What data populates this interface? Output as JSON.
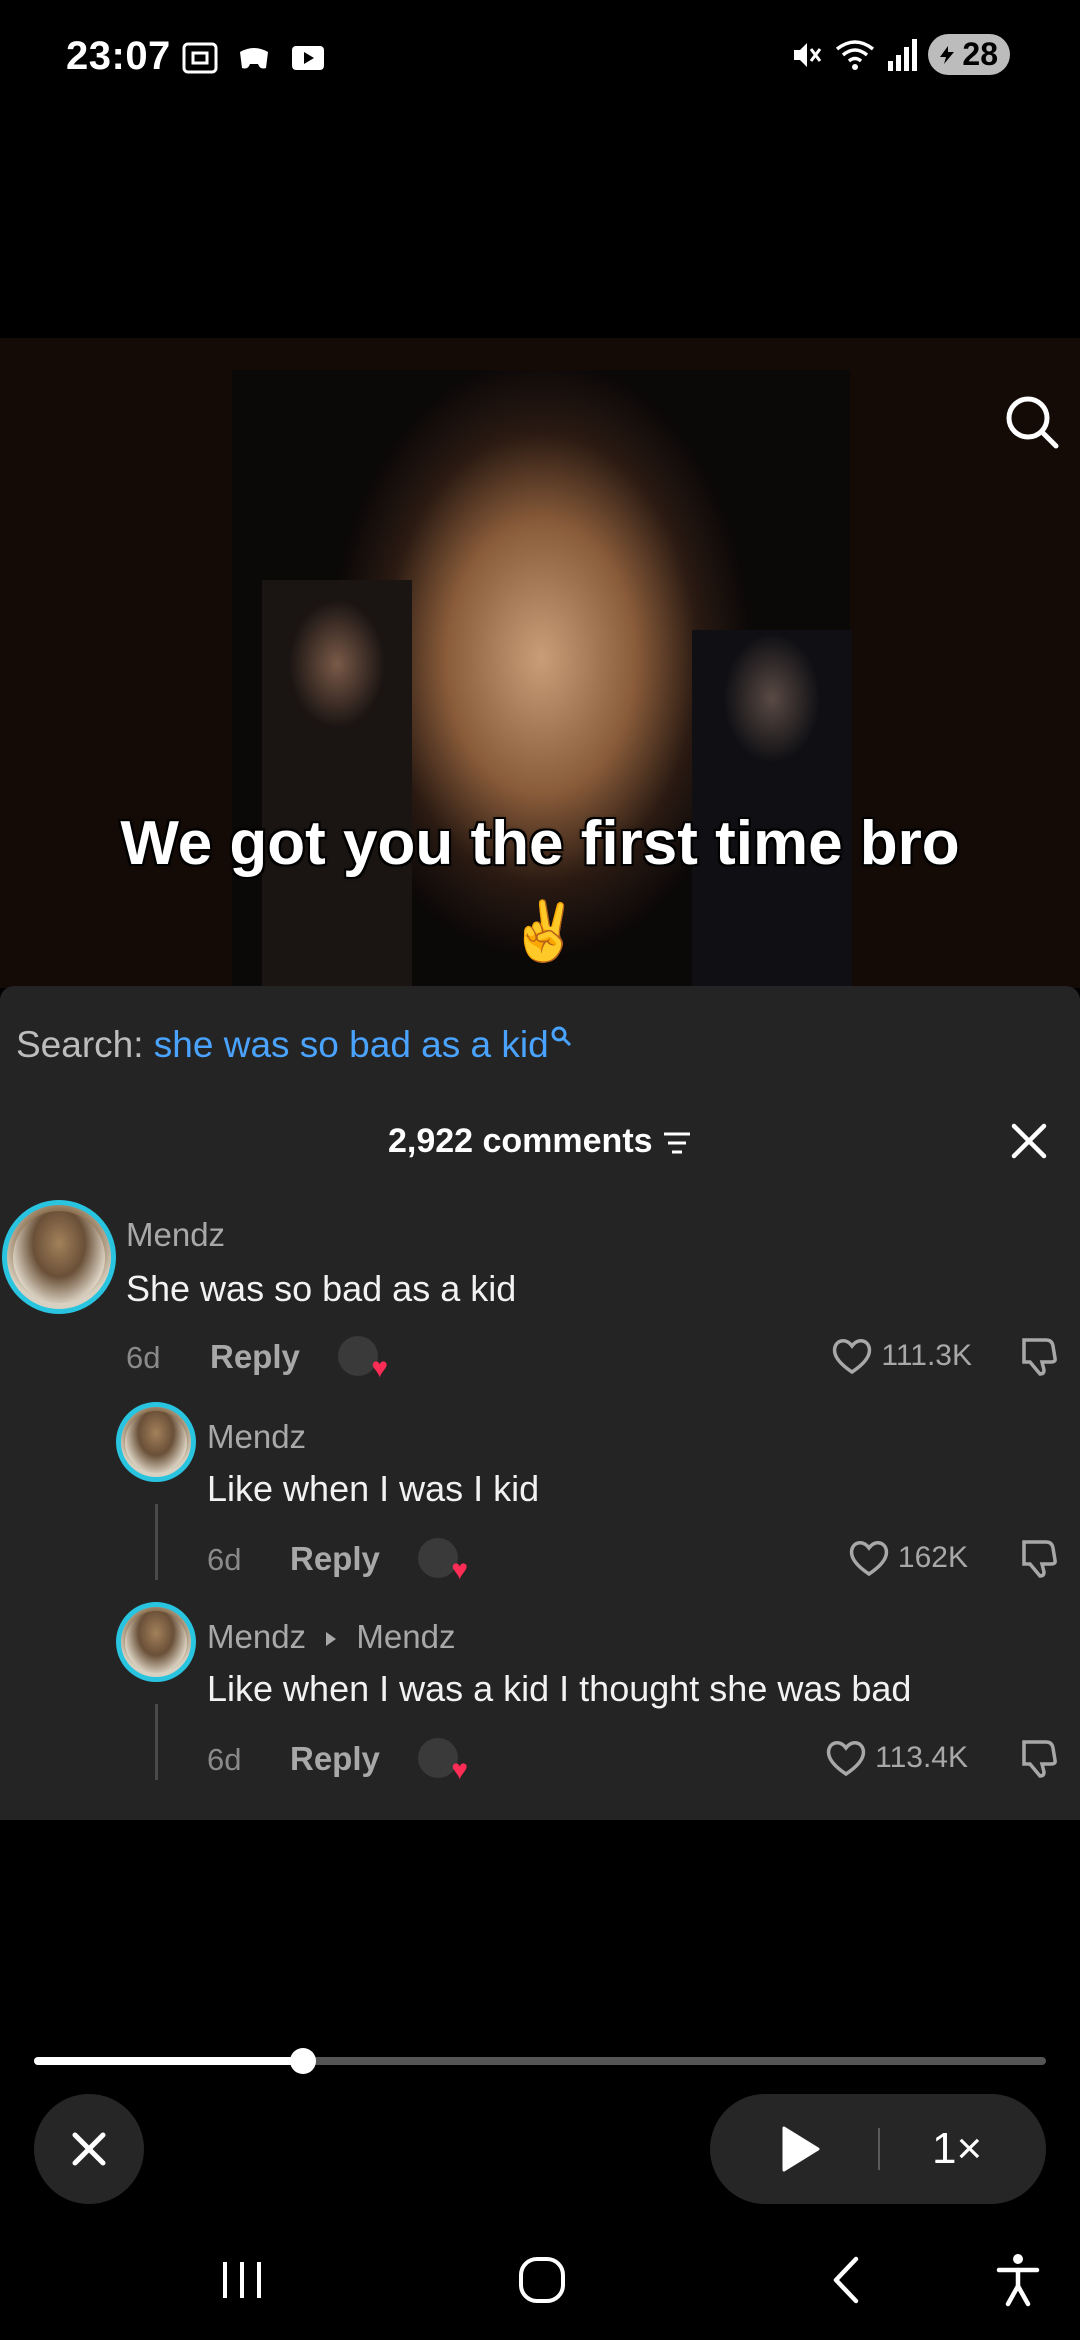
{
  "status": {
    "time": "23:07",
    "battery": "28",
    "left_icons": [
      "screenshot-icon",
      "game-icon",
      "media-icon"
    ],
    "right_icons": [
      "mute-icon",
      "wifi-icon",
      "signal-icon",
      "battery-icon"
    ]
  },
  "video": {
    "caption": "We got you the first time bro",
    "caption_emoji": "✌️"
  },
  "comments": {
    "search_prefix": "Search:",
    "search_query": "she was so bad as a kid",
    "count_label": "2,922 comments",
    "items": [
      {
        "user": "Mendz",
        "text": "She was so bad as a kid",
        "age": "6d",
        "reply": "Reply",
        "likes": "111.3K"
      },
      {
        "user": "Mendz",
        "text": "Like when I was I kid",
        "age": "6d",
        "reply": "Reply",
        "likes": "162K"
      },
      {
        "user": "Mendz",
        "reply_to": "Mendz",
        "text": "Like when I was a kid I thought she was bad",
        "age": "6d",
        "reply": "Reply",
        "likes": "113.4K"
      }
    ]
  },
  "player": {
    "progress": 0.266,
    "speed": "1×"
  },
  "colors": {
    "accent_blue": "#4aa3ff",
    "avatar_ring": "#29c4e0",
    "heart_red": "#ff2d55",
    "panel_bg": "#242424"
  }
}
